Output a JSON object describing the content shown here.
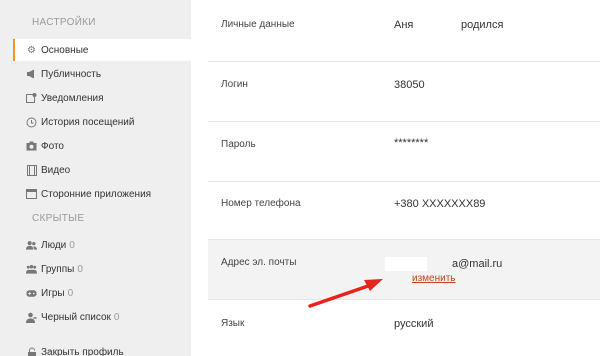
{
  "sidebar": {
    "settings_title": "НАСТРОЙКИ",
    "hidden_title": "СКРЫТЫЕ",
    "items": [
      {
        "label": "Основные",
        "icon": "gear-icon"
      },
      {
        "label": "Публичность",
        "icon": "megaphone-icon"
      },
      {
        "label": "Уведомления",
        "icon": "notification-icon"
      },
      {
        "label": "История посещений",
        "icon": "history-icon"
      },
      {
        "label": "Фото",
        "icon": "camera-icon"
      },
      {
        "label": "Видео",
        "icon": "film-icon"
      },
      {
        "label": "Сторонние приложения",
        "icon": "app-window-icon"
      }
    ],
    "hidden_items": [
      {
        "label": "Люди",
        "count": "0",
        "icon": "people-icon"
      },
      {
        "label": "Группы",
        "count": "0",
        "icon": "groups-icon"
      },
      {
        "label": "Игры",
        "count": "0",
        "icon": "gamepad-icon"
      },
      {
        "label": "Черный список",
        "count": "0",
        "icon": "blacklist-icon"
      }
    ],
    "close_profile": {
      "label": "Закрыть профиль",
      "icon": "lock-icon"
    }
  },
  "main": {
    "personal": {
      "label": "Личные данные",
      "name": "Аня",
      "extra": "родился"
    },
    "login": {
      "label": "Логин",
      "value": "38050"
    },
    "password": {
      "label": "Пароль",
      "value": "********"
    },
    "phone": {
      "label": "Номер телефона",
      "value": "+380 XXXXXXX89"
    },
    "email": {
      "label": "Адрес эл. почты",
      "value": "a@mail.ru",
      "change_link": "изменить"
    },
    "language": {
      "label": "Язык",
      "value": "русский"
    }
  },
  "colors": {
    "accent": "#f7931e",
    "link": "#c6401a",
    "arrow": "#e8231a",
    "sidebar_bg": "#efefef"
  }
}
